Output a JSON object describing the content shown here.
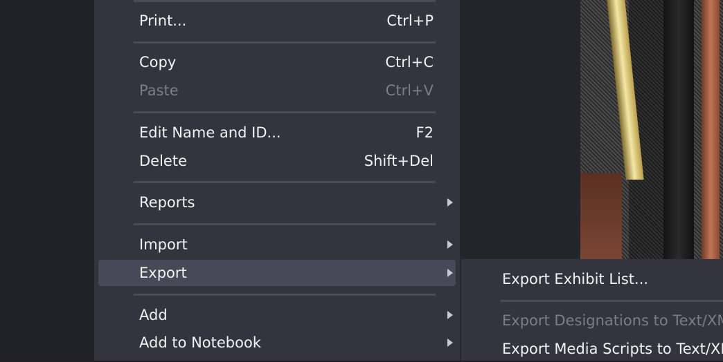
{
  "menu": {
    "items": [
      {
        "label": "Print...",
        "shortcut": "Ctrl+P"
      },
      {
        "label": "Copy",
        "shortcut": "Ctrl+C"
      },
      {
        "label": "Paste",
        "shortcut": "Ctrl+V",
        "disabled": true
      },
      {
        "label": "Edit Name and ID...",
        "shortcut": "F2"
      },
      {
        "label": "Delete",
        "shortcut": "Shift+Del"
      },
      {
        "label": "Reports",
        "submenu": true
      },
      {
        "label": "Import",
        "submenu": true
      },
      {
        "label": "Export",
        "submenu": true,
        "highlighted": true
      },
      {
        "label": "Add",
        "submenu": true
      },
      {
        "label": "Add to Notebook",
        "submenu": true
      }
    ]
  },
  "export_submenu": {
    "items": [
      {
        "label": "Export Exhibit List..."
      },
      {
        "label": "Export Designations to Text/XML...",
        "disabled": true
      },
      {
        "label": "Export Media Scripts to Text/XML..."
      }
    ]
  },
  "colors": {
    "menu_background": "#34343e",
    "highlight": "#484856",
    "text": "#f2f2f2",
    "disabled_text": "#7d7d87",
    "separator": "#4b4b56"
  }
}
